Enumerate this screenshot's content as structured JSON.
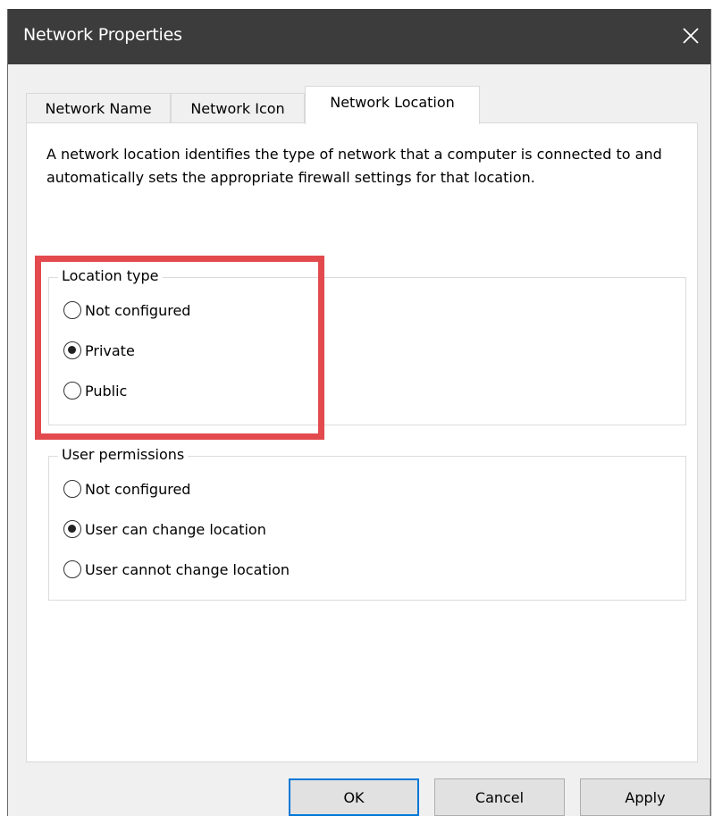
{
  "window": {
    "title": "Network Properties"
  },
  "tabs": [
    {
      "label": "Network Name",
      "active": false
    },
    {
      "label": "Network Icon",
      "active": false
    },
    {
      "label": "Network Location",
      "active": true
    }
  ],
  "description": "A network location identifies the type of network that a computer is connected to and automatically sets the appropriate firewall settings for that location.",
  "location_type": {
    "legend": "Location type",
    "options": [
      {
        "label": "Not configured",
        "checked": false
      },
      {
        "label": "Private",
        "checked": true
      },
      {
        "label": "Public",
        "checked": false
      }
    ]
  },
  "user_permissions": {
    "legend": "User permissions",
    "options": [
      {
        "label": "Not configured",
        "checked": false
      },
      {
        "label": "User can change location",
        "checked": true
      },
      {
        "label": "User cannot change location",
        "checked": false
      }
    ]
  },
  "buttons": {
    "ok": "OK",
    "cancel": "Cancel",
    "apply": "Apply"
  },
  "colors": {
    "titlebar": "#3c3c3c",
    "highlight": "#e24a4e",
    "default_button_border": "#0078d7"
  }
}
